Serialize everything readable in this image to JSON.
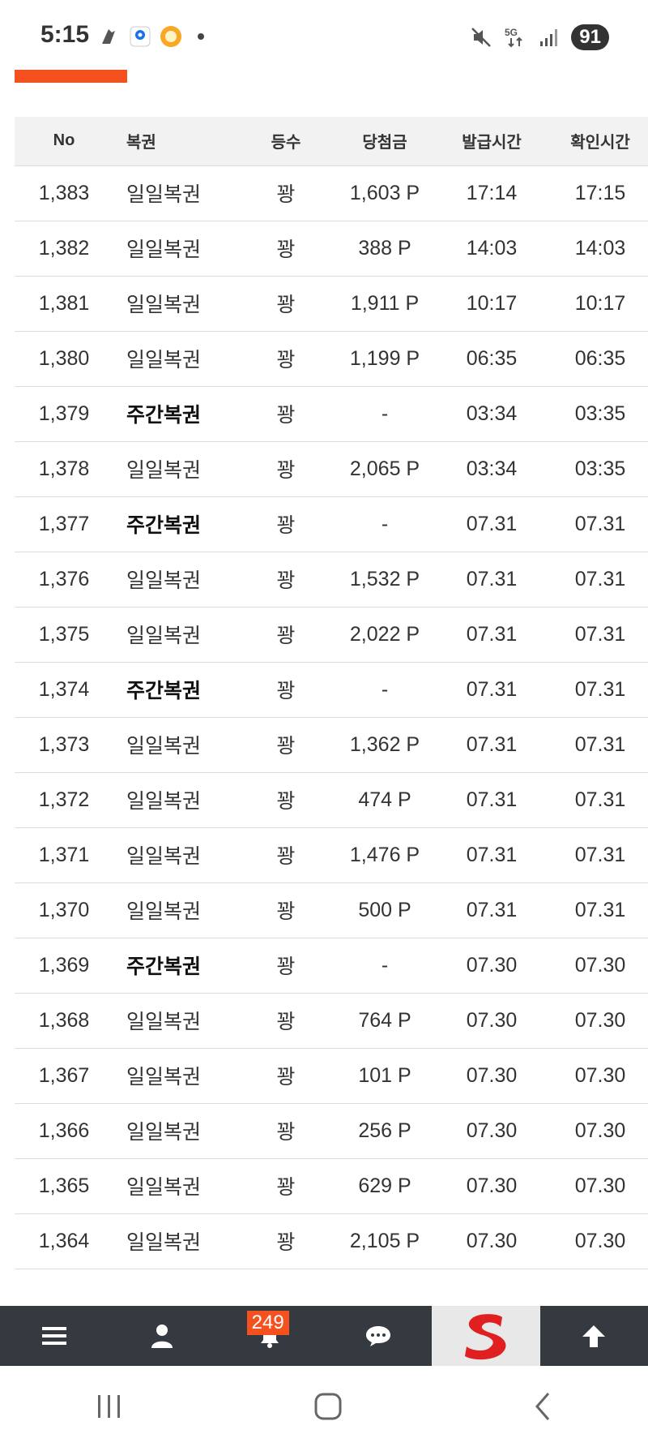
{
  "status_bar": {
    "time": "5:15",
    "left_icons": [
      "notification-app-icon",
      "maps-icon",
      "emoji-app-icon"
    ],
    "right_icons": [
      "mute-icon",
      "5g-icon",
      "signal-icon"
    ],
    "battery": "91"
  },
  "accent_color": "#f4511e",
  "table": {
    "headers": {
      "no": "No",
      "type": "복권",
      "rank": "등수",
      "prize": "당첨금",
      "issue_time": "발급시간",
      "check_time": "확인시간"
    },
    "rows": [
      {
        "no": "1,383",
        "type": "일일복권",
        "bold": false,
        "rank": "꽝",
        "prize": "1,603 P",
        "issue": "17:14",
        "check": "17:15"
      },
      {
        "no": "1,382",
        "type": "일일복권",
        "bold": false,
        "rank": "꽝",
        "prize": "388 P",
        "issue": "14:03",
        "check": "14:03"
      },
      {
        "no": "1,381",
        "type": "일일복권",
        "bold": false,
        "rank": "꽝",
        "prize": "1,911 P",
        "issue": "10:17",
        "check": "10:17"
      },
      {
        "no": "1,380",
        "type": "일일복권",
        "bold": false,
        "rank": "꽝",
        "prize": "1,199 P",
        "issue": "06:35",
        "check": "06:35"
      },
      {
        "no": "1,379",
        "type": "주간복권",
        "bold": true,
        "rank": "꽝",
        "prize": "-",
        "issue": "03:34",
        "check": "03:35"
      },
      {
        "no": "1,378",
        "type": "일일복권",
        "bold": false,
        "rank": "꽝",
        "prize": "2,065 P",
        "issue": "03:34",
        "check": "03:35"
      },
      {
        "no": "1,377",
        "type": "주간복권",
        "bold": true,
        "rank": "꽝",
        "prize": "-",
        "issue": "07.31",
        "check": "07.31"
      },
      {
        "no": "1,376",
        "type": "일일복권",
        "bold": false,
        "rank": "꽝",
        "prize": "1,532 P",
        "issue": "07.31",
        "check": "07.31"
      },
      {
        "no": "1,375",
        "type": "일일복권",
        "bold": false,
        "rank": "꽝",
        "prize": "2,022 P",
        "issue": "07.31",
        "check": "07.31"
      },
      {
        "no": "1,374",
        "type": "주간복권",
        "bold": true,
        "rank": "꽝",
        "prize": "-",
        "issue": "07.31",
        "check": "07.31"
      },
      {
        "no": "1,373",
        "type": "일일복권",
        "bold": false,
        "rank": "꽝",
        "prize": "1,362 P",
        "issue": "07.31",
        "check": "07.31"
      },
      {
        "no": "1,372",
        "type": "일일복권",
        "bold": false,
        "rank": "꽝",
        "prize": "474 P",
        "issue": "07.31",
        "check": "07.31"
      },
      {
        "no": "1,371",
        "type": "일일복권",
        "bold": false,
        "rank": "꽝",
        "prize": "1,476 P",
        "issue": "07.31",
        "check": "07.31"
      },
      {
        "no": "1,370",
        "type": "일일복권",
        "bold": false,
        "rank": "꽝",
        "prize": "500 P",
        "issue": "07.31",
        "check": "07.31"
      },
      {
        "no": "1,369",
        "type": "주간복권",
        "bold": true,
        "rank": "꽝",
        "prize": "-",
        "issue": "07.30",
        "check": "07.30"
      },
      {
        "no": "1,368",
        "type": "일일복권",
        "bold": false,
        "rank": "꽝",
        "prize": "764 P",
        "issue": "07.30",
        "check": "07.30"
      },
      {
        "no": "1,367",
        "type": "일일복권",
        "bold": false,
        "rank": "꽝",
        "prize": "101 P",
        "issue": "07.30",
        "check": "07.30"
      },
      {
        "no": "1,366",
        "type": "일일복권",
        "bold": false,
        "rank": "꽝",
        "prize": "256 P",
        "issue": "07.30",
        "check": "07.30"
      },
      {
        "no": "1,365",
        "type": "일일복권",
        "bold": false,
        "rank": "꽝",
        "prize": "629 P",
        "issue": "07.30",
        "check": "07.30"
      },
      {
        "no": "1,364",
        "type": "일일복권",
        "bold": false,
        "rank": "꽝",
        "prize": "2,105 P",
        "issue": "07.30",
        "check": "07.30"
      }
    ]
  },
  "bottom_nav": {
    "items": [
      {
        "icon": "menu-icon"
      },
      {
        "icon": "user-icon"
      },
      {
        "icon": "bell-icon",
        "badge": "249"
      },
      {
        "icon": "chat-icon"
      },
      {
        "icon": "site-logo-s"
      },
      {
        "icon": "arrow-up-icon"
      }
    ]
  },
  "system_nav": [
    "recents-icon",
    "home-icon",
    "back-icon"
  ]
}
